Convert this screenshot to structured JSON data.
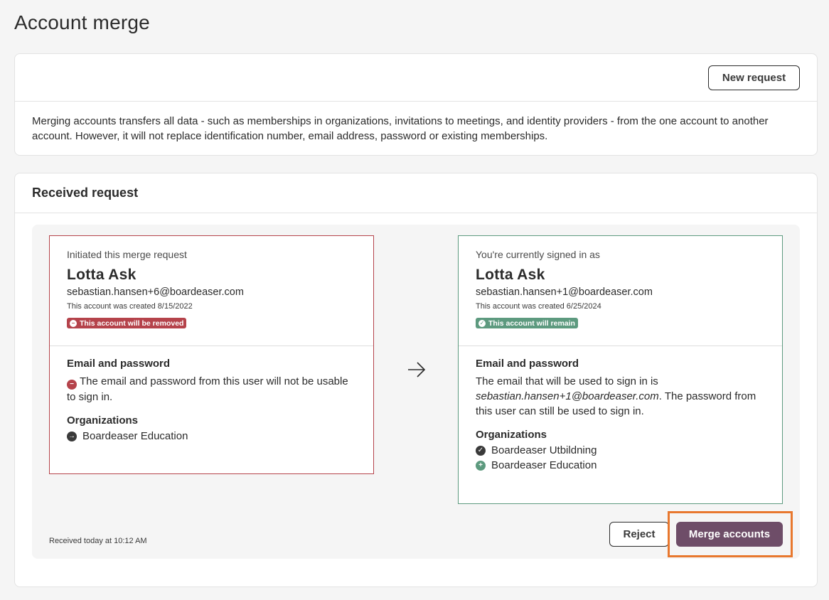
{
  "page": {
    "title": "Account merge"
  },
  "top_card": {
    "new_request_label": "New request",
    "description": "Merging accounts transfers all data - such as memberships in organizations, invitations to meetings, and identity providers - from the one account to another account. However, it will not replace identification number, email address, password or existing memberships."
  },
  "received": {
    "header": "Received request",
    "from": {
      "label": "Initiated this merge request",
      "name": "Lotta Ask",
      "email": "sebastian.hansen+6@boardeaser.com",
      "created": "This account was created 8/15/2022",
      "badge": "This account will be removed",
      "email_password_title": "Email and password",
      "email_password_text": "The email and password from this user will not be usable to sign in.",
      "organizations_title": "Organizations",
      "organizations": [
        "Boardeaser Education"
      ]
    },
    "to": {
      "label": "You're currently signed in as",
      "name": "Lotta Ask",
      "email": "sebastian.hansen+1@boardeaser.com",
      "created": "This account was created 6/25/2024",
      "badge": "This account will remain",
      "email_password_title": "Email and password",
      "email_password_prefix": "The email that will be used to sign in is",
      "email_password_email": "sebastian.hansen+1@boardeaser.com",
      "email_password_suffix": ". The password from this user can still be used to sign in.",
      "organizations_title": "Organizations",
      "organizations": [
        "Boardeaser Utbildning",
        "Boardeaser Education"
      ]
    },
    "received_at": "Received today at 10:12 AM",
    "reject_label": "Reject",
    "merge_label": "Merge accounts"
  },
  "colors": {
    "remove": "#b5434b",
    "remain": "#5d9a7f",
    "primary_button": "#6e4d68",
    "highlight": "#e8782e"
  }
}
